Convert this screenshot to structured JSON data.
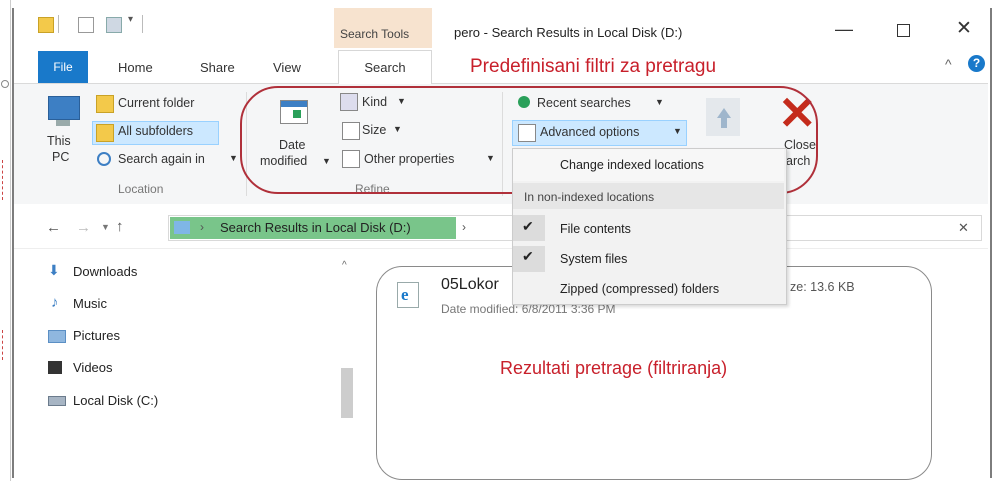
{
  "window": {
    "title": "pero - Search Results in Local Disk (D:)",
    "context_tab_group": "Search Tools"
  },
  "ribbon_tabs": {
    "file": "File",
    "home": "Home",
    "share": "Share",
    "view": "View",
    "search": "Search"
  },
  "annotation_top": "Predefinisani filtri za pretragu",
  "annotation_results": "Rezultati pretrage (filtriranja)",
  "ribbon": {
    "location": {
      "this_pc_line1": "This",
      "this_pc_line2": "PC",
      "current_folder": "Current folder",
      "all_subfolders": "All subfolders",
      "search_again_in": "Search again in",
      "group_label": "Location"
    },
    "refine": {
      "date_line1": "Date",
      "date_line2": "modified",
      "kind": "Kind",
      "size": "Size",
      "other_properties": "Other properties",
      "group_label": "Refine"
    },
    "options": {
      "recent_searches": "Recent searches",
      "advanced_options": "Advanced options",
      "open_file_partial": "Open file",
      "close_line1": "Close",
      "close_line2": "search",
      "close_partial_1": "Close",
      "close_partial_2": "arch"
    }
  },
  "dropdown_menu": {
    "change_indexed": "Change indexed locations",
    "section_header": "In non-indexed locations",
    "file_contents": "File contents",
    "system_files": "System files",
    "zipped": "Zipped (compressed) folders"
  },
  "address_bar": {
    "path": "Search Results in Local Disk (D:)",
    "separator": "›"
  },
  "nav_pane": {
    "items": [
      "Downloads",
      "Music",
      "Pictures",
      "Videos",
      "Local Disk (C:)"
    ]
  },
  "result": {
    "name": "05Lokor",
    "date_modified": "Date modified: 6/8/2011 3:36 PM",
    "size_partial": "ze: 13.6 KB"
  },
  "colors": {
    "accent_blue": "#1979ca",
    "annotation_red": "#c8202b",
    "search_tools_tab": "#f7e3cf",
    "close_x_red": "#c42b1c"
  }
}
